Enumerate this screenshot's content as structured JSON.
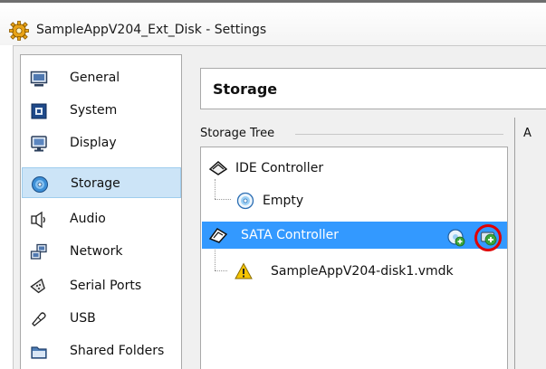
{
  "window": {
    "title": "SampleAppV204_Ext_Disk - Settings",
    "icon": "gear-icon"
  },
  "sidebar": {
    "items": [
      {
        "label": "General",
        "icon": "general-icon",
        "selected": false
      },
      {
        "label": "System",
        "icon": "system-chip-icon",
        "selected": false
      },
      {
        "label": "Display",
        "icon": "display-monitor-icon",
        "selected": false
      },
      {
        "label": "Storage",
        "icon": "storage-disk-icon",
        "selected": true
      },
      {
        "label": "Audio",
        "icon": "audio-speaker-icon",
        "selected": false
      },
      {
        "label": "Network",
        "icon": "network-icon",
        "selected": false
      },
      {
        "label": "Serial Ports",
        "icon": "serial-port-icon",
        "selected": false
      },
      {
        "label": "USB",
        "icon": "usb-icon",
        "selected": false
      },
      {
        "label": "Shared Folders",
        "icon": "folder-icon",
        "selected": false
      }
    ]
  },
  "main": {
    "heading": "Storage",
    "tree_label": "Storage Tree",
    "attributes_label_clipped": "A",
    "tree": {
      "ide_controller": {
        "label": "IDE Controller",
        "icon": "ide-controller-icon"
      },
      "ide_empty": {
        "label": "Empty",
        "icon": "optical-disc-icon"
      },
      "sata_controller": {
        "label": "SATA Controller",
        "icon": "sata-controller-icon",
        "selected": true,
        "add_optical_icon": "add-optical-drive-icon",
        "add_hard_disk_icon": "add-hard-disk-icon"
      },
      "sata_disk": {
        "label": "SampleAppV204-disk1.vmdk",
        "icon": "warning-icon"
      }
    }
  },
  "colors": {
    "selection_blue": "#3399ff",
    "sidebar_selection": "#cce4f7",
    "highlight_ring": "#e00000",
    "add_icon_green": "#3aa63a"
  }
}
